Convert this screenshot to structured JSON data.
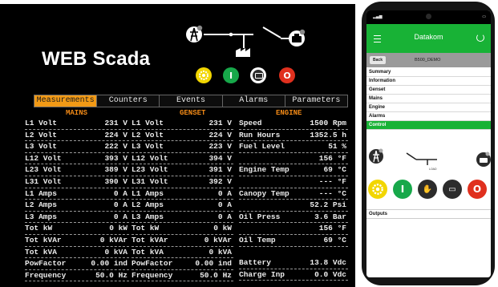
{
  "scada": {
    "title": "WEB Scada",
    "buttons": {
      "auto_icon": "gear-icon",
      "run_label": "I",
      "manual_icon": "manual-mode-icon",
      "stop_label": "O"
    },
    "tabs": [
      "Measurements",
      "Counters",
      "Events",
      "Alarms",
      "Parameters"
    ],
    "active_tab": "Measurements",
    "sections": {
      "mains": "MAINS",
      "genset": "GENSET",
      "engine": "ENGINE"
    },
    "mains_rows": [
      {
        "label": "L1 Volt",
        "value": "231 V"
      },
      {
        "label": "L2 Volt",
        "value": "224 V"
      },
      {
        "label": "L3 Volt",
        "value": "222 V"
      },
      {
        "label": "L12 Volt",
        "value": "393 V"
      },
      {
        "label": "L23 Volt",
        "value": "389 V"
      },
      {
        "label": "L31 Volt",
        "value": "390 V"
      },
      {
        "label": "L1 Amps",
        "value": "0 A"
      },
      {
        "label": "L2 Amps",
        "value": "0 A"
      },
      {
        "label": "L3 Amps",
        "value": "0 A"
      },
      {
        "label": "Tot kW",
        "value": "0 kW"
      },
      {
        "label": "Tot kVAr",
        "value": "0 kVAr"
      },
      {
        "label": "Tot kVA",
        "value": "0 kVA"
      },
      {
        "label": "PowFactor",
        "value": "0.00 ind"
      },
      {
        "label": "Frequency",
        "value": "50.0 Hz"
      }
    ],
    "genset_rows": [
      {
        "label": "L1 Volt",
        "value": "231 V"
      },
      {
        "label": "L2 Volt",
        "value": "224 V"
      },
      {
        "label": "L3 Volt",
        "value": "223 V"
      },
      {
        "label": "L12 Volt",
        "value": "394 V"
      },
      {
        "label": "L23 Volt",
        "value": "391 V"
      },
      {
        "label": "L31 Volt",
        "value": "392 V"
      },
      {
        "label": "L1 Amps",
        "value": "0 A"
      },
      {
        "label": "L2 Amps",
        "value": "0 A"
      },
      {
        "label": "L3 Amps",
        "value": "0 A"
      },
      {
        "label": "Tot kW",
        "value": "0 kW"
      },
      {
        "label": "Tot kVAr",
        "value": "0 kVAr"
      },
      {
        "label": "Tot kVA",
        "value": "0 kVA"
      },
      {
        "label": "PowFactor",
        "value": "0.00 ind"
      },
      {
        "label": "Frequency",
        "value": "50.0 Hz"
      }
    ],
    "engine_rows": [
      {
        "label": "Speed",
        "value": "1500 Rpm"
      },
      {
        "label": "Run Hours",
        "value": "1352.5 h"
      },
      {
        "label": "Fuel Level",
        "value": "51 %"
      },
      {
        "label": "",
        "value": "156 °F"
      },
      {
        "label": "Engine Temp",
        "value": "69 °C"
      },
      {
        "label": "",
        "value": "--- °F"
      },
      {
        "label": "Canopy Temp",
        "value": "--- °C"
      },
      {
        "label": "",
        "value": "52.2 Psi"
      },
      {
        "label": "Oil Press",
        "value": "3.6 Bar"
      },
      {
        "label": "",
        "value": "156 °F"
      },
      {
        "label": "Oil Temp",
        "value": "69 °C"
      },
      {
        "label": "",
        "value": ""
      },
      {
        "label": "Battery",
        "value": "13.8 Vdc"
      },
      {
        "label": "Charge Inp",
        "value": "0.0 Vdc"
      }
    ]
  },
  "phone": {
    "app_title": "Datakom",
    "back_label": "Back",
    "device_name": "B500_DEMO",
    "menu": [
      "Summary",
      "Information",
      "Genset",
      "Mains",
      "Engine",
      "Alarms",
      "Control"
    ],
    "active_menu": "Control",
    "load_label": "LOAD",
    "buttons": {
      "run": "I",
      "stop": "O"
    },
    "outputs_label": "Outputs"
  },
  "colors": {
    "accent_orange": "#f29a16",
    "app_green": "#18b236",
    "run_green": "#17a84a",
    "stop_red": "#e0301e",
    "auto_yellow": "#f2d600"
  }
}
